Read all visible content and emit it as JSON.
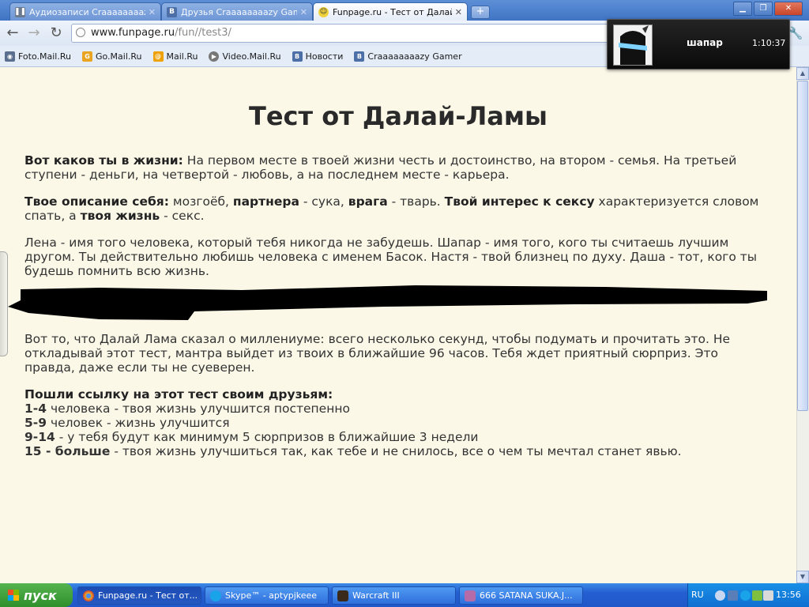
{
  "tabs": [
    {
      "label": "Аудиозаписи Craaaaaaaazy",
      "icon": "pause-icon"
    },
    {
      "label": "Друзья Craaaaaaaazy Game",
      "icon": "vk-icon"
    },
    {
      "label": "Funpage.ru - Тест от Далай-Л",
      "icon": "funpage-smiley-icon",
      "active": true
    }
  ],
  "address": {
    "host": "www.funpage.ru",
    "path": "/fun//test3/"
  },
  "bookmarks": [
    {
      "label": "Foto.Mail.Ru",
      "icon": "camera-icon"
    },
    {
      "label": "Go.Mail.Ru",
      "icon": "go-mail-icon"
    },
    {
      "label": "Mail.Ru",
      "icon": "mail-ru-icon"
    },
    {
      "label": "Video.Mail.Ru",
      "icon": "video-icon"
    },
    {
      "label": "Новости",
      "icon": "vk-icon"
    },
    {
      "label": "Craaaaaaaazy Gamer",
      "icon": "vk-icon"
    }
  ],
  "popup": {
    "name": "шапар",
    "time": "1:10:37"
  },
  "page": {
    "title": "Тест от Далай-Ламы",
    "p1": {
      "lead": "Вот каков ты в жизни:",
      "text": "  На первом месте в твоей жизни честь и достоинство, на втором - семья. На третьей ступени - деньги, на четвертой - любовь, а на последнем месте - карьера."
    },
    "p2": {
      "b1": "Твое описание себя:",
      "t1": " мозгоёб, ",
      "b2": "партнера",
      "t2": " - сука, ",
      "b3": "врага",
      "t3": " - тварь. ",
      "b4": "Твой интерес к сексу",
      "t4": " характеризуется словом спать, а ",
      "b5": "твоя жизнь",
      "t5": " - секс."
    },
    "p3": "Лена - имя того человека, который тебя никогда не забудешь. Шапар - имя того, кого ты считаешь лучшим другом. Ты действительно любишь человека с именем Басок. Настя - твой близнец по духу. Даша - тот, кого ты будешь помнить всю жизнь.",
    "p4": "Вот то, что Далай Лама сказал о миллениуме: всего несколько секунд, чтобы подумать и прочитать это. Не откладывай этот тест, мантра выйдет из твоих в ближайшие 96 часов. Тебя ждет приятный сюрприз. Это правда, даже если ты не суеверен.",
    "share_heading": "Пошли ссылку на этот тест своим друзьям:",
    "list": [
      {
        "bold": "1-4",
        "text": " человека - твоя жизнь улучшится постепенно"
      },
      {
        "bold": "5-9",
        "text": " человек - жизнь улучшится"
      },
      {
        "bold": "9-14",
        "text": " - у тебя будут как минимум 5 сюрпризов в ближайшие 3 недели"
      },
      {
        "bold": "15 - больше",
        "text": " - твоя жизнь улучшиться так, как тебе и не снилось, все о чем ты мечтал станет явью."
      }
    ]
  },
  "taskbar": {
    "start": "пуск",
    "tasks": [
      {
        "label": "Funpage.ru - Тест от...",
        "icon": "chrome-icon",
        "active": true
      },
      {
        "label": "Skype™ - aptypjkeee",
        "icon": "skype-icon"
      },
      {
        "label": "Warcraft III",
        "icon": "warcraft-icon"
      },
      {
        "label": "666 SATANA SUKA.J...",
        "icon": "archive-icon"
      }
    ],
    "lang": "RU",
    "clock": "13:56"
  },
  "colors": {
    "page_bg": "#fbf8e8",
    "text": "#333333",
    "taskbar": "#245ed1",
    "start": "#3c9a37"
  }
}
